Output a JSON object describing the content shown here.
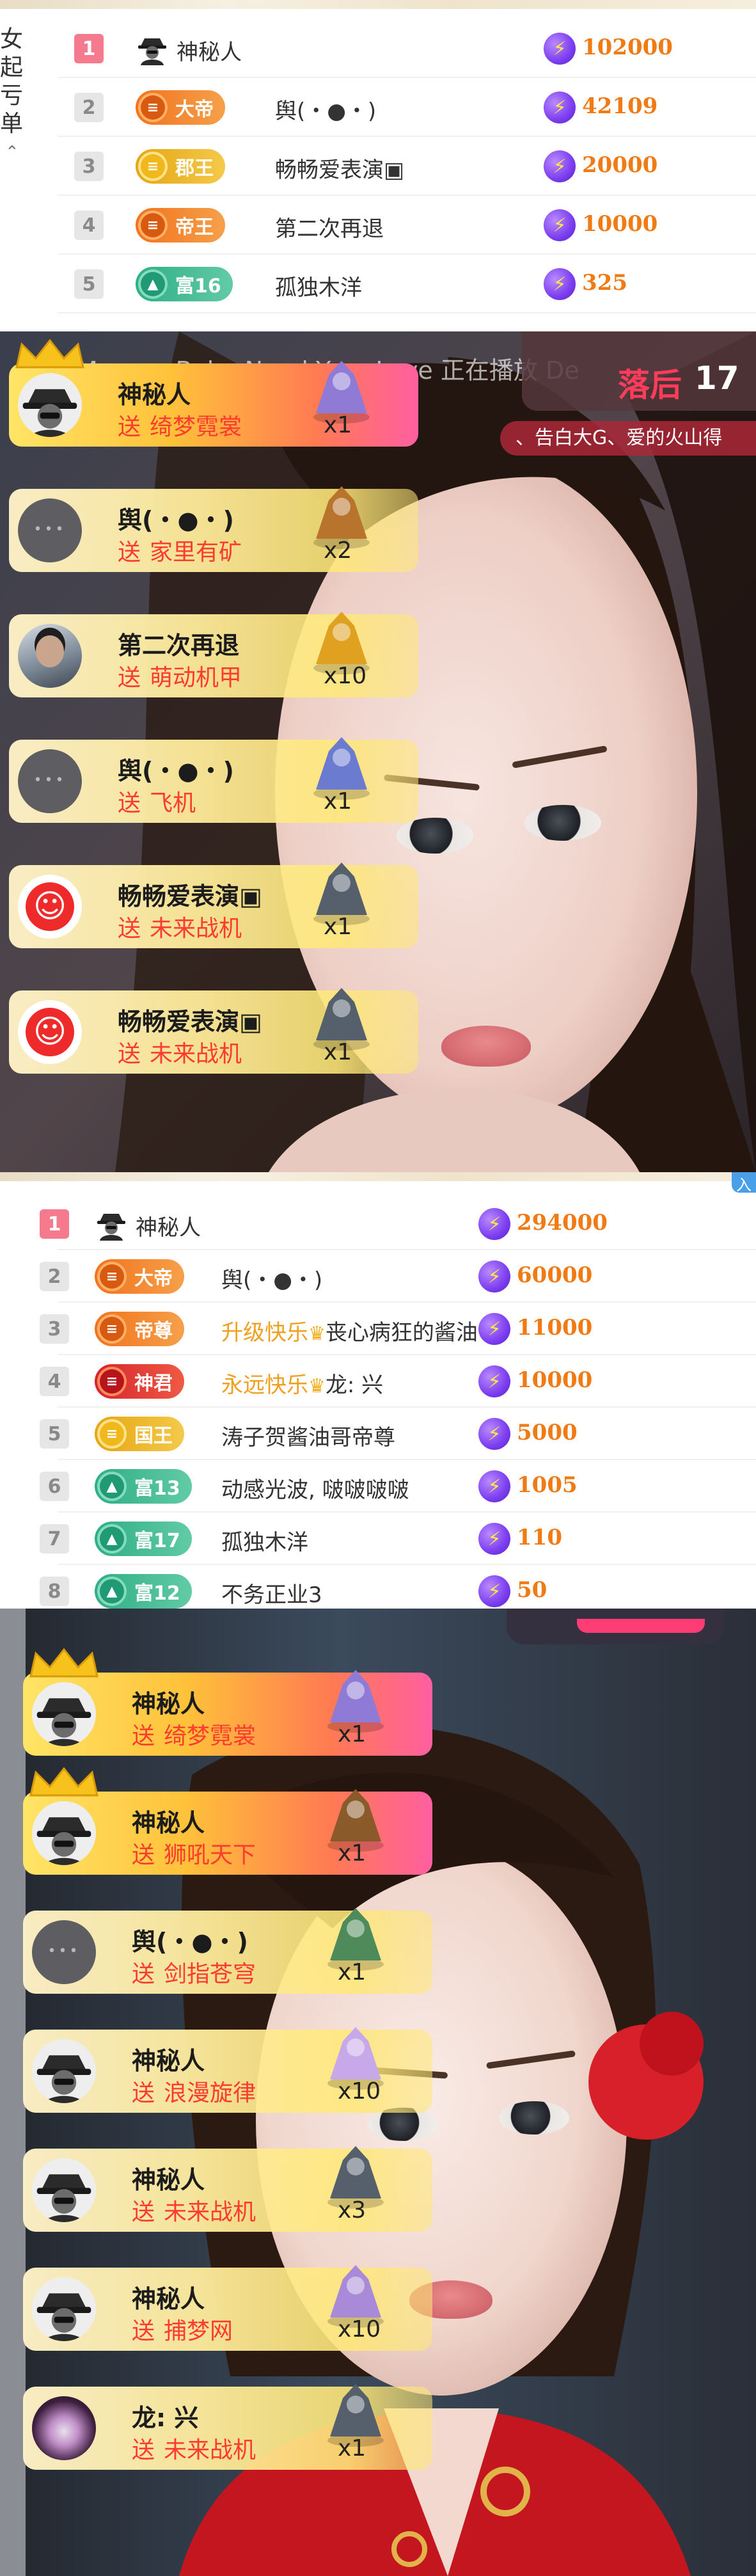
{
  "board1": {
    "side_tab": [
      "女起",
      "亏单"
    ],
    "rows": [
      {
        "rank": "1",
        "badge": null,
        "name": "神秘人",
        "mystery": true,
        "score": "102000"
      },
      {
        "rank": "2",
        "badge": {
          "style": "orange",
          "text": "大帝"
        },
        "name": "舆(・●・)",
        "score": "42109"
      },
      {
        "rank": "3",
        "badge": {
          "style": "gold",
          "text": "郡王"
        },
        "name": "畅畅爱表演▣",
        "score": "20000"
      },
      {
        "rank": "4",
        "badge": {
          "style": "orange",
          "text": "帝王"
        },
        "name": "第二次再退",
        "score": "10000"
      },
      {
        "rank": "5",
        "badge": {
          "style": "green",
          "text": "富16"
        },
        "name": "孤独木洋",
        "score": "325"
      }
    ]
  },
  "stream1": {
    "marquee": "Morgan Baby Need Your Love  正在播放  De",
    "pk_label": "落后",
    "pk_value": "17",
    "ticker": "、告白大G、爱的火山得",
    "gifts": [
      {
        "user": "神秘人",
        "action": "送",
        "gift": "绮梦霓裳",
        "count": "x1",
        "avatar": "myst",
        "vip": true,
        "gift_color": "#8f7bd6"
      },
      {
        "user": "舆(・●・)",
        "action": "送",
        "gift": "家里有矿",
        "count": "x2",
        "avatar": "grey",
        "vip": false,
        "gift_color": "#b8742c"
      },
      {
        "user": "第二次再退",
        "action": "送",
        "gift": "萌动机甲",
        "count": "x10",
        "avatar": "photo",
        "vip": false,
        "gift_color": "#e0a020"
      },
      {
        "user": "舆(・●・)",
        "action": "送",
        "gift": "飞机",
        "count": "x1",
        "avatar": "grey",
        "vip": false,
        "gift_color": "#6b7bd0"
      },
      {
        "user": "畅畅爱表演▣",
        "action": "送",
        "gift": "未来战机",
        "count": "x1",
        "avatar": "red",
        "vip": false,
        "gift_color": "#55606c"
      },
      {
        "user": "畅畅爱表演▣",
        "action": "送",
        "gift": "未来战机",
        "count": "x1",
        "avatar": "red",
        "vip": false,
        "gift_color": "#55606c"
      }
    ]
  },
  "board2": {
    "corner_tag": "入",
    "rows": [
      {
        "rank": "1",
        "badge": null,
        "name": "神秘人",
        "mystery": true,
        "score": "294000"
      },
      {
        "rank": "2",
        "badge": {
          "style": "orange",
          "text": "大帝"
        },
        "name": "舆(・●・)",
        "score": "60000"
      },
      {
        "rank": "3",
        "badge": {
          "style": "orange",
          "text": "帝尊"
        },
        "name_hl": "升级快乐",
        "name_tail": "丧心病狂的酱油",
        "score": "11000"
      },
      {
        "rank": "4",
        "badge": {
          "style": "red",
          "text": "神君"
        },
        "name_hl": "永远快乐",
        "name_tail": "龙: 兴",
        "score": "10000"
      },
      {
        "rank": "5",
        "badge": {
          "style": "gold",
          "text": "国王"
        },
        "name": "涛子贺酱油哥帝尊",
        "score": "5000"
      },
      {
        "rank": "6",
        "badge": {
          "style": "green",
          "text": "富13"
        },
        "name": "动感光波, 啵啵啵啵",
        "score": "1005"
      },
      {
        "rank": "7",
        "badge": {
          "style": "green",
          "text": "富17"
        },
        "name": "孤独木洋",
        "score": "110"
      },
      {
        "rank": "8",
        "badge": {
          "style": "green",
          "text": "富12"
        },
        "name": "不务正业3",
        "score": "50"
      }
    ]
  },
  "stream2": {
    "gifts": [
      {
        "user": "神秘人",
        "action": "送",
        "gift": "绮梦霓裳",
        "count": "x1",
        "avatar": "myst",
        "vip": true,
        "gift_color": "#8f7bd6"
      },
      {
        "user": "神秘人",
        "action": "送",
        "gift": "狮吼天下",
        "count": "x1",
        "avatar": "myst",
        "vip": true,
        "gift_color": "#8b5a2b"
      },
      {
        "user": "舆(・●・)",
        "action": "送",
        "gift": "剑指苍穹",
        "count": "x1",
        "avatar": "grey",
        "vip": false,
        "gift_color": "#4f8a5a"
      },
      {
        "user": "神秘人",
        "action": "送",
        "gift": "浪漫旋律",
        "count": "x10",
        "avatar": "myst",
        "vip": false,
        "gift_color": "#c7a8e8"
      },
      {
        "user": "神秘人",
        "action": "送",
        "gift": "未来战机",
        "count": "x3",
        "avatar": "myst",
        "vip": false,
        "gift_color": "#55606c"
      },
      {
        "user": "神秘人",
        "action": "送",
        "gift": "捕梦网",
        "count": "x10",
        "avatar": "myst",
        "vip": false,
        "gift_color": "#a98ad8"
      },
      {
        "user": "龙: 兴",
        "action": "送",
        "gift": "未来战机",
        "count": "x1",
        "avatar": "flower",
        "vip": false,
        "gift_color": "#55606c"
      }
    ]
  }
}
